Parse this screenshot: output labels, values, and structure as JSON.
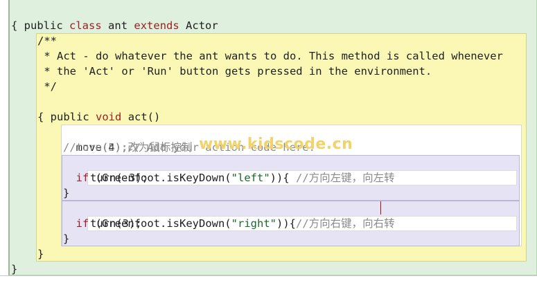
{
  "editor": {
    "class_decl": {
      "kw1": "public",
      "kw2": "class",
      "name": "ant",
      "kw3": "extends",
      "parent": "Actor"
    },
    "open_brace": "{",
    "close_brace": "}",
    "javadoc": [
      "/**",
      " * Act - do whatever the ant wants to do. This method is called whenever",
      " * the 'Act' or 'Run' button gets pressed in the environment.",
      " */"
    ],
    "method_decl": {
      "kw1": "public",
      "kw2": "void",
      "name": "act()"
    },
    "method_open": "{",
    "method_close": "}",
    "lines": {
      "move_code": "move(4);",
      "move_comment": "// Add your action code here.",
      "turn_comment_line": "//turn(5);改为鼠标控制",
      "if1": {
        "kw": "if",
        "pre": " (Greenfoot.isKeyDown(",
        "str": "\"left\"",
        "post": ")){ ",
        "comment": "//方向左键，向左转"
      },
      "if1_body": "turn(-3);",
      "if1_close": "}",
      "if2": {
        "kw": "if",
        "pre": " (Greenfoot.isKeyDown(",
        "str": "\"right\"",
        "post": ")){",
        "comment": "//方向右键，向右转"
      },
      "if2_body": "turn(3);",
      "if2_close": "}"
    },
    "watermark": "www.kidscode.cn"
  },
  "colors": {
    "class_scope": "#dff1de",
    "method_scope": "#fbf7b4",
    "if_scope": "#e6e4f4",
    "keyword": "#9a1e1e",
    "string": "#1a6a2a",
    "comment": "#8a8a8a"
  }
}
